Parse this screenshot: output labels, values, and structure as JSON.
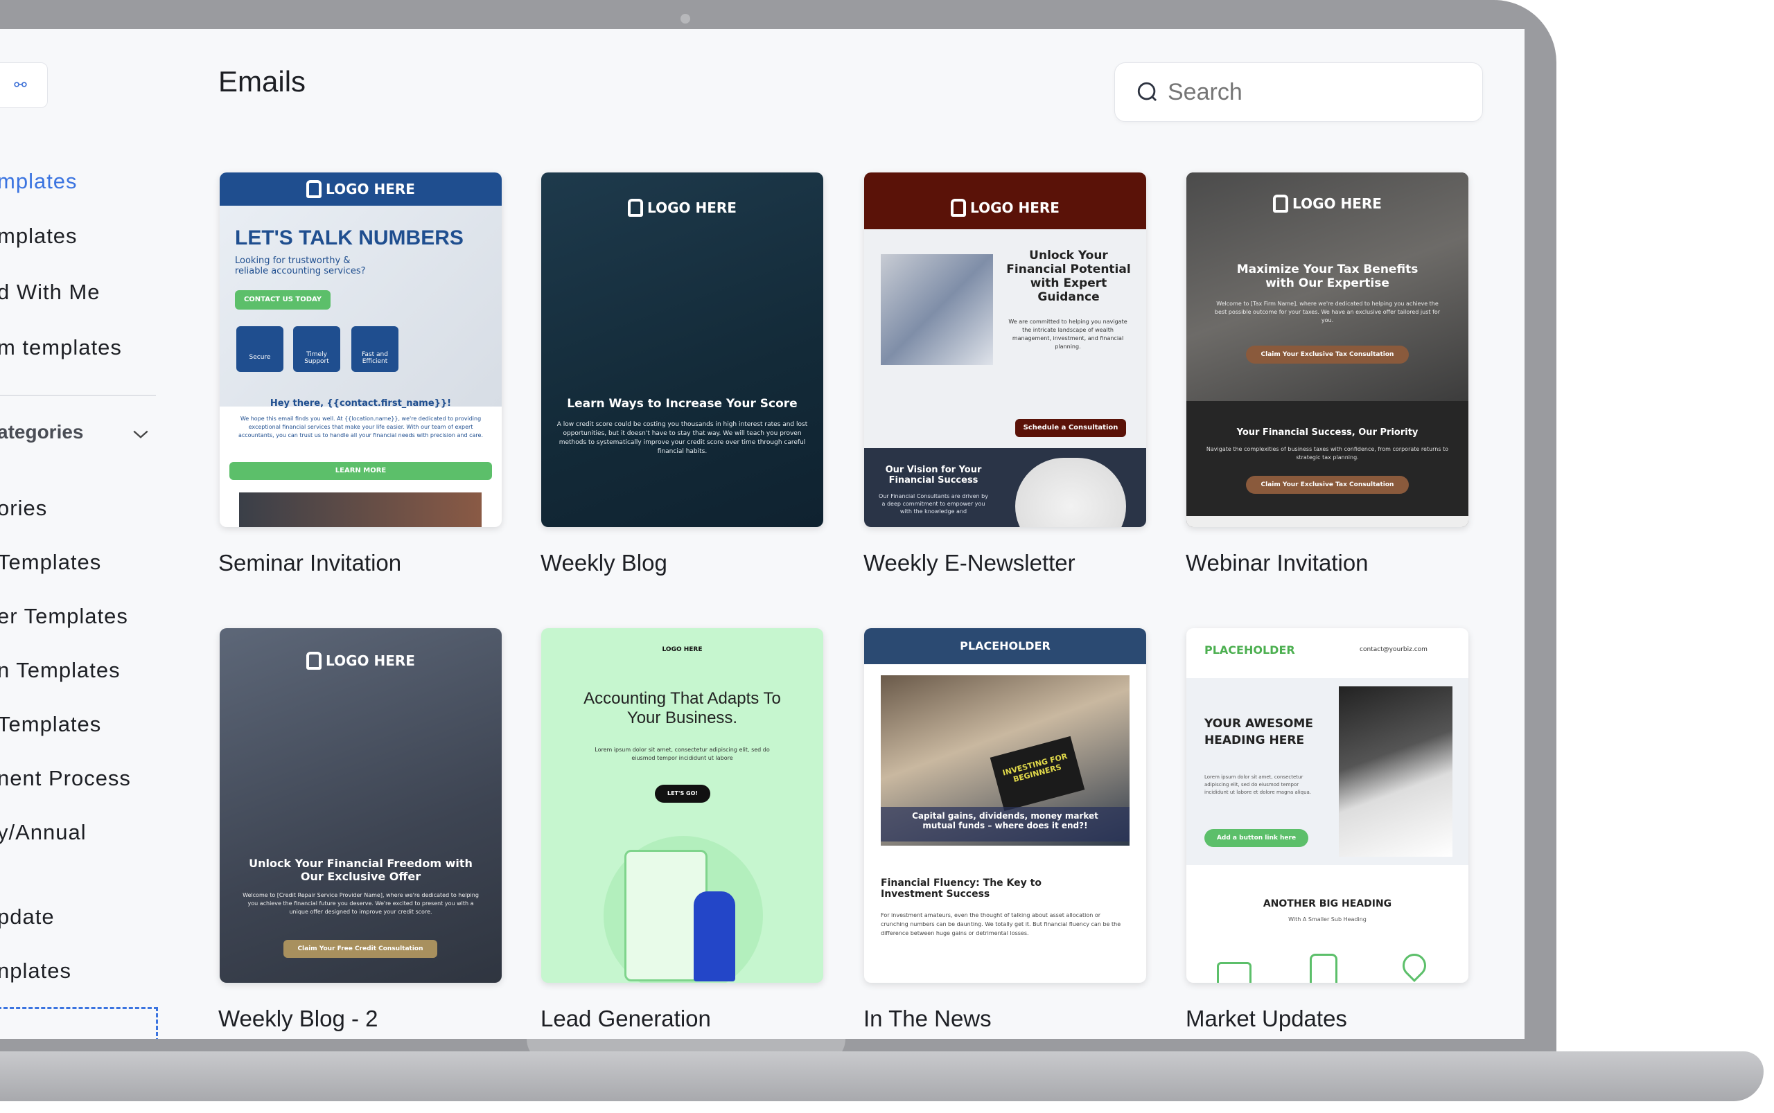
{
  "sidebar": {
    "items": [
      "mplates",
      "mplates",
      "d With Me",
      "m templates"
    ],
    "categories_label": "ategories",
    "category_items": [
      "ories",
      "Templates",
      "er Templates",
      "n Templates",
      "Templates",
      "nent Process",
      "y/Annual",
      "pdate",
      "nplates"
    ]
  },
  "header": {
    "title": "Emails",
    "search_placeholder": "Search"
  },
  "accent": "#3b74e0",
  "templates": [
    {
      "name": "Seminar Invitation",
      "logo": "LOGO HERE",
      "headline": "LET'S TALK NUMBERS",
      "sub": "Looking for trustworthy & reliable accounting services?",
      "cta": "CONTACT US TODAY",
      "features": [
        "Secure",
        "Timely Support",
        "Fast and Efficient"
      ],
      "greeting": "Hey there, {{contact.first_name}}!",
      "body": "We hope this email finds you well. At {{location.name}}, we're dedicated to providing exceptional financial services that make your life easier. With our team of expert accountants, you can trust us to handle all your financial needs with precision and care.",
      "button": "LEARN MORE"
    },
    {
      "name": "Weekly Blog",
      "logo": "LOGO HERE",
      "headline": "Learn Ways to Increase Your Score",
      "body": "A low credit score could be costing you thousands in high interest rates and lost opportunities, but it doesn't have to stay that way. We will teach you proven methods to systematically improve your credit score over time through careful financial habits."
    },
    {
      "name": "Weekly E-Newsletter",
      "logo": "LOGO HERE",
      "headline": "Unlock Your Financial Potential with Expert Guidance",
      "body": "We are committed to helping you navigate the intricate landscape of wealth management, investment, and financial planning.",
      "button": "Schedule a Consultation",
      "section": "Our Vision for Your Financial Success",
      "section_body": "Our Financial Consultants are driven by a deep commitment to empower you with the knowledge and"
    },
    {
      "name": "Webinar Invitation",
      "logo": "LOGO HERE",
      "headline": "Maximize Your Tax Benefits with Our Expertise",
      "body": "Welcome to [Tax Firm Name], where we're dedicated to helping you achieve the best possible outcome for your taxes. We have an exclusive offer tailored just for you.",
      "button": "Claim Your Exclusive Tax Consultation",
      "section": "Your Financial Success, Our Priority",
      "section_body": "Navigate the complexities of business taxes with confidence, from corporate returns to strategic tax planning."
    },
    {
      "name": "Weekly Blog - 2",
      "logo": "LOGO HERE",
      "headline": "Unlock Your Financial Freedom with Our Exclusive Offer",
      "body": "Welcome to [Credit Repair Service Provider Name], where we're dedicated to helping you achieve the financial future you deserve. We're excited to present you with a unique offer designed to improve your credit score.",
      "button": "Claim Your Free Credit Consultation"
    },
    {
      "name": "Lead Generation",
      "logo": "LOGO HERE",
      "headline": "Accounting That Adapts To Your Business.",
      "body": "Lorem ipsum dolor sit amet, consectetur adipiscing elit, sed do eiusmod tempor incididunt ut labore",
      "button": "LET'S GO!"
    },
    {
      "name": "In The News",
      "logo": "PLACEHOLDER",
      "caption": "Capital gains, dividends, money market mutual funds – where does it end?!",
      "book": "INVESTING FOR BEGINNERS",
      "headline": "Financial Fluency: The Key to Investment Success",
      "body": "For investment amateurs, even the thought of talking about asset allocation or crunching numbers can be daunting. We totally get it. But financial fluency can be the difference between huge gains or detrimental losses."
    },
    {
      "name": "Market Updates",
      "logo": "PLACEHOLDER",
      "email": "contact@yourbiz.com",
      "headline": "YOUR AWESOME HEADING HERE",
      "body": "Lorem ipsum dolor sit amet, consectetur adipiscing elit, sed do eiusmod tempor incididunt ut labore et dolore magna aliqua.",
      "button": "Add a button link here",
      "section": "ANOTHER BIG HEADING",
      "section_sub": "With A Smaller Sub Heading"
    }
  ]
}
